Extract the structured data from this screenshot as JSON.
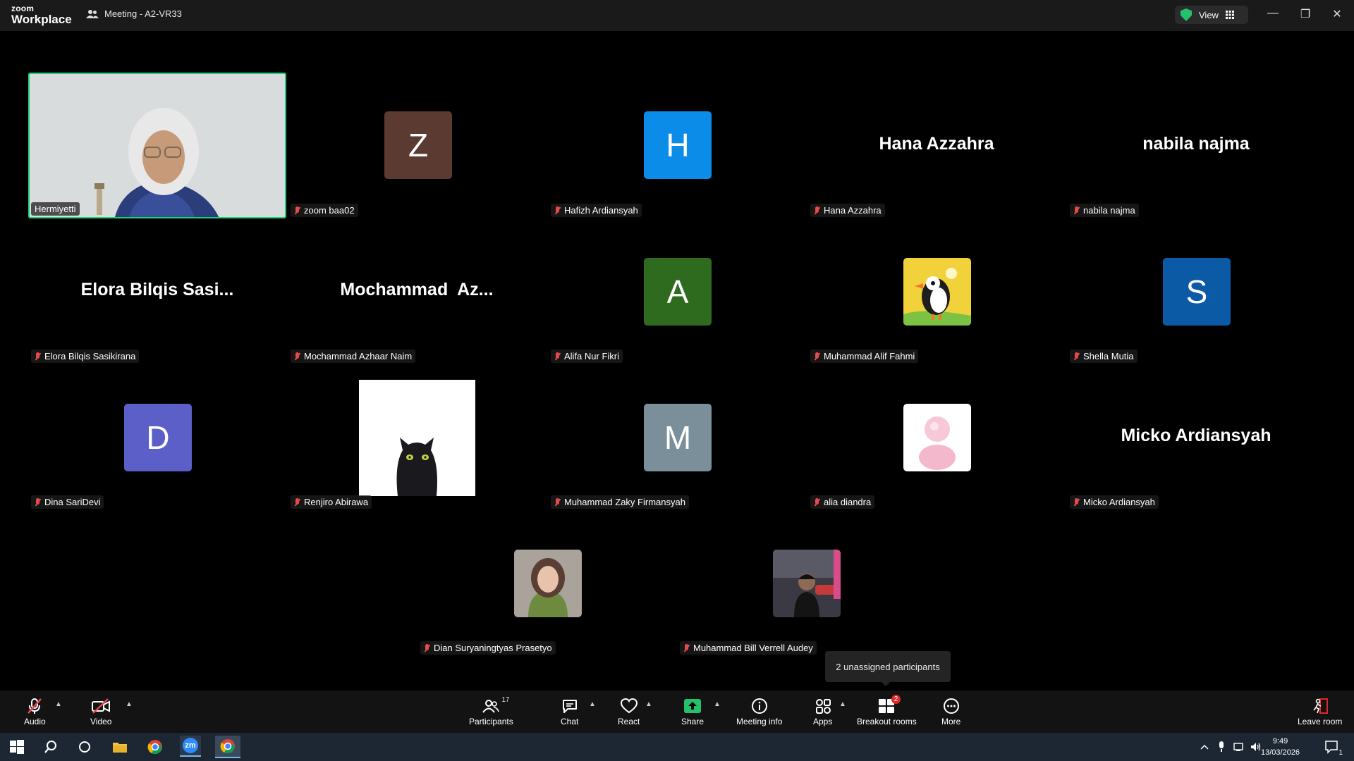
{
  "app": {
    "logo_line1": "zoom",
    "logo_line2": "Workplace",
    "meeting_title": "Meeting - A2-VR33",
    "view_label": "View"
  },
  "colors": {
    "accent_green": "#1fd075",
    "mic_muted": "#e54b4b",
    "toolbar_bg": "#131313",
    "share_green": "#23c16b",
    "badge_red": "#e02828"
  },
  "participants": [
    {
      "name": "Hermiyetti",
      "type": "video",
      "active": true
    },
    {
      "name": "zoom baa02",
      "type": "initial",
      "initial": "Z",
      "color": "#5b3a31"
    },
    {
      "name": "Hafizh Ardiansyah",
      "type": "initial",
      "initial": "H",
      "color": "#0c8ce9"
    },
    {
      "name": "Hana Azzahra",
      "type": "text",
      "display": "Hana Azzahra"
    },
    {
      "name": "nabila najma",
      "type": "text",
      "display": "nabila najma"
    },
    {
      "name": "Elora Bilqis Sasikirana",
      "type": "text",
      "display": "Elora Bilqis Sasi..."
    },
    {
      "name": "Mochammad Azhaar Naim",
      "type": "text",
      "display": "Mochammad  Az..."
    },
    {
      "name": "Alifa Nur Fikri",
      "type": "initial",
      "initial": "A",
      "color": "#2e6b1f"
    },
    {
      "name": "Muhammad Alif Fahmi",
      "type": "image",
      "image": "puffin"
    },
    {
      "name": "Shella Mutia",
      "type": "initial",
      "initial": "S",
      "color": "#0b5aa6"
    },
    {
      "name": "Dina SariDevi",
      "type": "initial",
      "initial": "D",
      "color": "#5b5fc7"
    },
    {
      "name": "Renjiro Abirawa",
      "type": "image",
      "image": "toothless"
    },
    {
      "name": "Muhammad Zaky Firmansyah",
      "type": "initial",
      "initial": "M",
      "color": "#7b8f9a"
    },
    {
      "name": "alia diandra",
      "type": "image",
      "image": "pink-bubble"
    },
    {
      "name": "Micko Ardiansyah",
      "type": "text",
      "display": "Micko Ardiansyah"
    },
    {
      "name": "Dian Suryaningtyas Prasetyo",
      "type": "image",
      "image": "photo-woman"
    },
    {
      "name": "Muhammad Bill Verrell Audey",
      "type": "image",
      "image": "photo-man"
    }
  ],
  "tooltip": "2 unassigned participants",
  "toolbar": {
    "audio": "Audio",
    "video": "Video",
    "participants": "Participants",
    "participants_count": "17",
    "chat": "Chat",
    "react": "React",
    "share": "Share",
    "meeting_info": "Meeting info",
    "apps": "Apps",
    "breakout": "Breakout rooms",
    "breakout_badge": "2",
    "more": "More",
    "leave": "Leave room"
  },
  "taskbar": {
    "time": "9:49",
    "date": "13/03/2026",
    "notification_count": "1",
    "zoom_icon_label": "zm"
  }
}
